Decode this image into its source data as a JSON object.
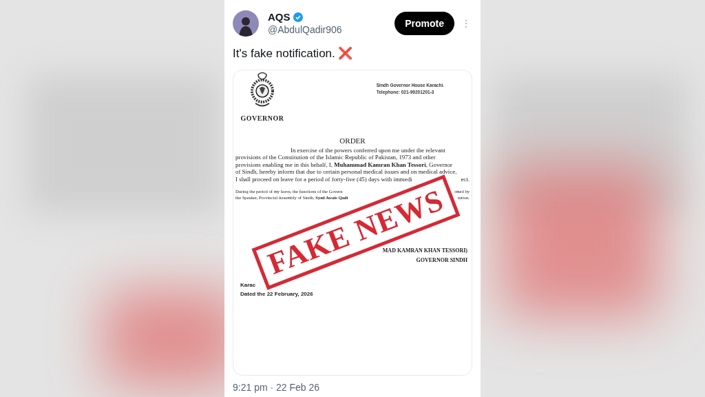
{
  "tweet": {
    "author": {
      "name": "AQS",
      "verified": true,
      "handle": "@AbdulQadir906"
    },
    "promote_button": "Promote",
    "more_button": "⋮",
    "text": "It's fake notification.",
    "emoji": "❌",
    "document": {
      "seal_caption": "GOVERNOR",
      "address": [
        "Sindh Governor House Karachi.",
        "Telephone: 021-99201201-3"
      ],
      "heading": "ORDER",
      "paragraph_1": [
        {
          "parts": [
            "In exercise of the powers conferred upon me under the relevant"
          ]
        },
        {
          "parts": [
            "provisions of the Constitution of the Islamic Republic of Pakistan, 1973 and other"
          ]
        },
        {
          "parts": [
            "provisions enabling me in this behalf, I, **Muhammad Kamran Khan Tessori**, Governor"
          ]
        },
        {
          "parts": [
            "of Sindh, hereby inform that due to certain personal medical issues and on medical advice,"
          ]
        },
        {
          "parts": [
            "I shall proceed on leave for a period of forty-five (45) days with immedi",
            "ect."
          ]
        }
      ],
      "paragraph_2": [
        {
          "parts": [
            "During the period of my leave, the functions of the Govern",
            "rmed by"
          ]
        },
        {
          "parts": [
            "the Speaker, Provincial Assembly of Sindh, **Syed Awais Qadi**",
            "tution."
          ]
        }
      ],
      "signature": [
        "MAD KAMRAN KHAN TESSORI)",
        "GOVERNOR SINDH"
      ],
      "place": "Karac",
      "date": "Dated the 22 February, 2026",
      "stamp": "FAKE NEWS"
    },
    "timestamp": "9:21 pm · 22 Feb 26"
  }
}
